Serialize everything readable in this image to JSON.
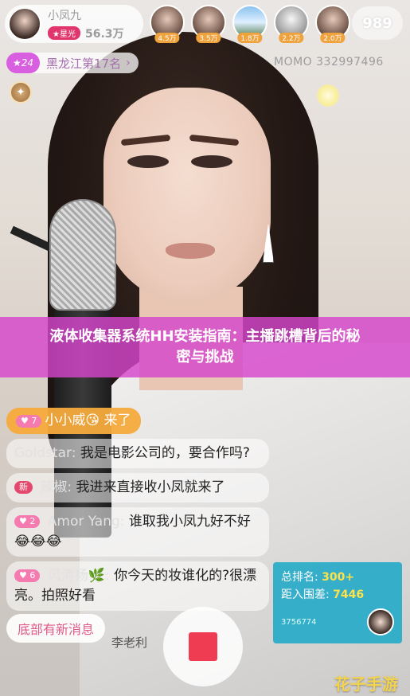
{
  "host": {
    "name": "小凤九",
    "star_badge": "★星光",
    "fans": "56.3万"
  },
  "viewers": [
    {
      "count": "4.5万"
    },
    {
      "count": "3.5万"
    },
    {
      "count": "1.8万"
    },
    {
      "count": "2.2万"
    },
    {
      "count": "2.0万"
    }
  ],
  "viewer_count": "989",
  "rank": {
    "number": "★24",
    "label": "黑龙江第17名",
    "arrow": "›"
  },
  "momo_id": "MOMO 332997496",
  "banner": {
    "line1": "液体收集器系统HH安装指南：主播跳槽背后的秘",
    "line2": "密与挑战"
  },
  "chat": [
    {
      "badge": "♥ 7",
      "name": "小小威",
      "text": "😘 来了",
      "highlight": true
    },
    {
      "badge": "",
      "name": "Goldstar:",
      "text": "我是电影公司的，要合作吗?",
      "highlight": false
    },
    {
      "badge": "新",
      "name": "辣椒:",
      "text": "我进来直接收小凤就来了",
      "highlight": false
    },
    {
      "badge": "♥ 2",
      "name": "Amor Yang:",
      "text": "谁取我小凤九好不好😂😂😂",
      "highlight": false
    },
    {
      "badge": "♥ 6",
      "name": "风清杨🌿:",
      "text": "你今天的妆谁化的?很漂亮。拍照好看",
      "highlight": false
    }
  ],
  "new_messages": "底部有新消息",
  "bottom_name": "李老利",
  "rank_card": {
    "total_label": "总排名:",
    "total_value": "300+",
    "gap_label": "距入围差:",
    "gap_value": "7446",
    "uid": "3756774"
  },
  "watermark": "花子手游"
}
